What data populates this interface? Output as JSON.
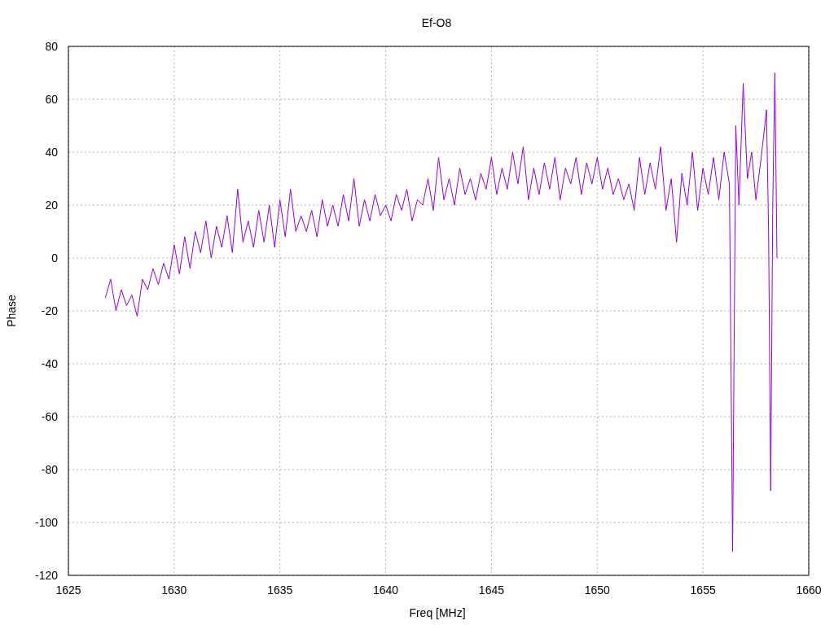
{
  "chart": {
    "chart_data": {
      "type": "line",
      "grid": true,
      "title": "Ef-O8",
      "xlabel": "Freq [MHz]",
      "ylabel": "Phase",
      "xlim": [
        1625,
        1660
      ],
      "ylim": [
        -120,
        80
      ],
      "xticks": [
        1625,
        1630,
        1635,
        1640,
        1645,
        1650,
        1655,
        1660
      ],
      "yticks": [
        -120,
        -100,
        -80,
        -60,
        -40,
        -20,
        0,
        20,
        40,
        60,
        80
      ],
      "x": [
        1626.75,
        1627,
        1627.25,
        1627.5,
        1627.75,
        1628,
        1628.25,
        1628.5,
        1628.75,
        1629,
        1629.25,
        1629.5,
        1629.75,
        1630,
        1630.25,
        1630.5,
        1630.75,
        1631,
        1631.25,
        1631.5,
        1631.75,
        1632,
        1632.25,
        1632.5,
        1632.75,
        1633,
        1633.25,
        1633.5,
        1633.75,
        1634,
        1634.25,
        1634.5,
        1634.75,
        1635,
        1635.25,
        1635.5,
        1635.75,
        1636,
        1636.25,
        1636.5,
        1636.75,
        1637,
        1637.25,
        1637.5,
        1637.75,
        1638,
        1638.25,
        1638.5,
        1638.75,
        1639,
        1639.25,
        1639.5,
        1639.75,
        1640,
        1640.25,
        1640.5,
        1640.75,
        1641,
        1641.25,
        1641.5,
        1641.75,
        1642,
        1642.25,
        1642.5,
        1642.75,
        1643,
        1643.25,
        1643.5,
        1643.75,
        1644,
        1644.25,
        1644.5,
        1644.75,
        1645,
        1645.25,
        1645.5,
        1645.75,
        1646,
        1646.25,
        1646.5,
        1646.75,
        1647,
        1647.25,
        1647.5,
        1647.75,
        1648,
        1648.25,
        1648.5,
        1648.75,
        1649,
        1649.25,
        1649.5,
        1649.75,
        1650,
        1650.25,
        1650.5,
        1650.75,
        1651,
        1651.25,
        1651.5,
        1651.75,
        1652,
        1652.25,
        1652.5,
        1652.75,
        1653,
        1653.25,
        1653.5,
        1653.75,
        1654,
        1654.25,
        1654.5,
        1654.75,
        1655,
        1655.25,
        1655.5,
        1655.75,
        1656,
        1656.25,
        1656.4,
        1656.55,
        1656.7,
        1656.9,
        1657.1,
        1657.3,
        1657.5,
        1657.75,
        1658,
        1658.1,
        1658.2,
        1658.3,
        1658.4,
        1658.5
      ],
      "series": [
        {
          "color": "#9400d3",
          "values": [
            -15,
            -8,
            -20,
            -12,
            -18,
            -14,
            -22,
            -8,
            -12,
            -4,
            -10,
            -2,
            -8,
            5,
            -6,
            8,
            -4,
            10,
            2,
            14,
            0,
            12,
            4,
            16,
            2,
            26,
            6,
            14,
            4,
            18,
            6,
            20,
            4,
            22,
            8,
            26,
            10,
            16,
            10,
            18,
            8,
            22,
            12,
            20,
            12,
            24,
            14,
            30,
            12,
            22,
            14,
            24,
            16,
            20,
            14,
            24,
            18,
            26,
            14,
            22,
            20,
            30,
            18,
            38,
            22,
            30,
            20,
            34,
            24,
            30,
            22,
            32,
            26,
            38,
            24,
            34,
            26,
            40,
            28,
            42,
            22,
            34,
            24,
            36,
            26,
            38,
            22,
            34,
            28,
            38,
            24,
            36,
            28,
            38,
            26,
            34,
            24,
            30,
            22,
            28,
            18,
            38,
            24,
            36,
            26,
            42,
            18,
            30,
            6,
            32,
            20,
            40,
            18,
            34,
            24,
            38,
            22,
            40,
            28,
            -111,
            50,
            20,
            66,
            30,
            40,
            22,
            38,
            56,
            10,
            -88,
            20,
            70,
            0
          ]
        }
      ]
    }
  }
}
